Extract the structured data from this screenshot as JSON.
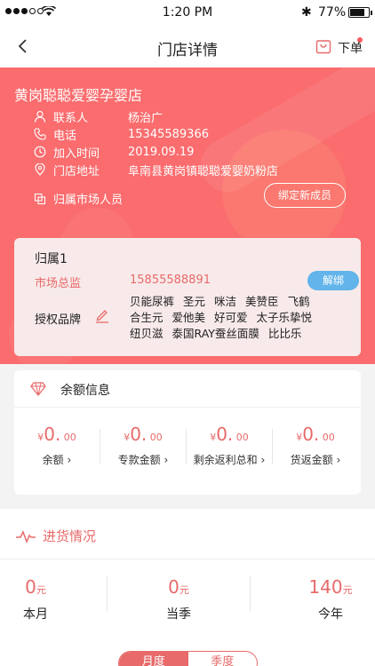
{
  "status_bar": {
    "time": "1:20 PM",
    "battery": "77%"
  },
  "nav": {
    "title": "门店详情",
    "order_label": "下单"
  },
  "store": {
    "name": "黄岗聪聪爱婴孕婴店",
    "fields": [
      {
        "label": "联系人",
        "value": "杨治广"
      },
      {
        "label": "电话",
        "value": "15345589366"
      },
      {
        "label": "加入时间",
        "value": "2019.09.19"
      },
      {
        "label": "门店地址",
        "value": "阜南县黄岗镇聪聪爱婴奶粉店"
      }
    ],
    "member_label": "归属市场人员",
    "bind_button": "绑定新成员"
  },
  "belong": {
    "title": "归属1",
    "supervisor_label": "市场总监",
    "supervisor_phone": "15855588891",
    "unbind_button": "解绑",
    "brand_label": "授权品牌",
    "brands": [
      "贝能尿裤",
      "圣元",
      "咪洁",
      "美赞臣",
      "飞鹤",
      "合生元",
      "爱他美",
      "好可爱",
      "太子乐挚悦",
      "纽贝滋",
      "泰国RAY蚕丝面膜",
      "比比乐"
    ]
  },
  "balance": {
    "title": "余额信息",
    "items": [
      {
        "currency": "¥",
        "int": "0.",
        "dec": "00",
        "label": "余额"
      },
      {
        "currency": "¥",
        "int": "0.",
        "dec": "00",
        "label": "专款金额"
      },
      {
        "currency": "¥",
        "int": "0.",
        "dec": "00",
        "label": "剩余返利总和"
      },
      {
        "currency": "¥",
        "int": "0.",
        "dec": "00",
        "label": "货返金额"
      }
    ]
  },
  "purchase": {
    "title": "进货情况",
    "unit": "元",
    "items": [
      {
        "value": "0",
        "label": "本月"
      },
      {
        "value": "0",
        "label": "当季"
      },
      {
        "value": "140",
        "label": "今年"
      }
    ],
    "tabs": [
      "月度",
      "季度"
    ]
  }
}
